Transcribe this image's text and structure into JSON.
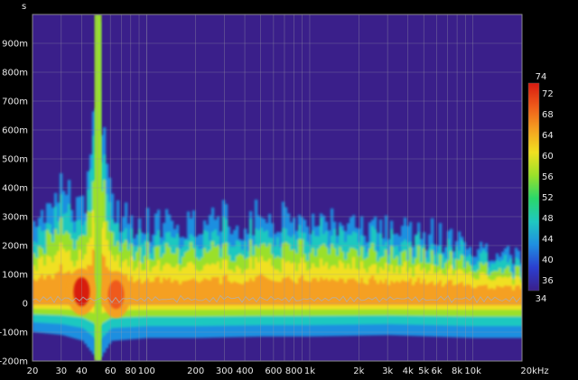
{
  "chart_data": {
    "type": "heatmap",
    "y_unit_label": "s",
    "x_scale": "log",
    "x_range_hz": [
      20,
      20000
    ],
    "y_range_ms": [
      -200,
      1000
    ],
    "x_ticks": [
      {
        "value": 20,
        "label": "20"
      },
      {
        "value": 30,
        "label": "30"
      },
      {
        "value": 40,
        "label": "40"
      },
      {
        "value": 60,
        "label": "60"
      },
      {
        "value": 80,
        "label": "80"
      },
      {
        "value": 100,
        "label": "100"
      },
      {
        "value": 200,
        "label": "200"
      },
      {
        "value": 300,
        "label": "300"
      },
      {
        "value": 400,
        "label": "400"
      },
      {
        "value": 600,
        "label": "600"
      },
      {
        "value": 800,
        "label": "800"
      },
      {
        "value": 1000,
        "label": "1k"
      },
      {
        "value": 2000,
        "label": "2k"
      },
      {
        "value": 3000,
        "label": "3k"
      },
      {
        "value": 4000,
        "label": "4k"
      },
      {
        "value": 5000,
        "label": "5k"
      },
      {
        "value": 6000,
        "label": "6k"
      },
      {
        "value": 8000,
        "label": "8k"
      },
      {
        "value": 10000,
        "label": "10k"
      },
      {
        "value": 20000,
        "label": "20kHz"
      }
    ],
    "y_ticks": [
      {
        "value": 900,
        "label": "900m"
      },
      {
        "value": 800,
        "label": "800m"
      },
      {
        "value": 700,
        "label": "700m"
      },
      {
        "value": 600,
        "label": "600m"
      },
      {
        "value": 500,
        "label": "500m"
      },
      {
        "value": 400,
        "label": "400m"
      },
      {
        "value": 300,
        "label": "300m"
      },
      {
        "value": 200,
        "label": "200m"
      },
      {
        "value": 100,
        "label": "100m"
      },
      {
        "value": 0,
        "label": "0"
      },
      {
        "value": -100,
        "label": "-100m"
      },
      {
        "value": -200,
        "label": "-200m"
      }
    ],
    "colorbar": {
      "range_db": [
        34,
        74
      ],
      "ticks": [
        {
          "value": 74,
          "label": "74"
        },
        {
          "value": 72,
          "label": "72"
        },
        {
          "value": 68,
          "label": "68"
        },
        {
          "value": 64,
          "label": "64"
        },
        {
          "value": 60,
          "label": "60"
        },
        {
          "value": 56,
          "label": "56"
        },
        {
          "value": 52,
          "label": "52"
        },
        {
          "value": 48,
          "label": "48"
        },
        {
          "value": 44,
          "label": "44"
        },
        {
          "value": 40,
          "label": "40"
        },
        {
          "value": 36,
          "label": "36"
        },
        {
          "value": 34,
          "label": "34"
        }
      ],
      "stops": [
        "#3a1f8a",
        "#2b3fd0",
        "#1f8fe0",
        "#1fc8c0",
        "#2ad86a",
        "#9ae02a",
        "#f0e020",
        "#f5a020",
        "#ef5a1a",
        "#d81a10"
      ]
    },
    "background_color": "#3a1f8a",
    "grid": true,
    "envelope_ms": [
      {
        "f": 20,
        "top": 320,
        "bottom": -100
      },
      {
        "f": 30,
        "top": 460,
        "bottom": -110
      },
      {
        "f": 40,
        "top": 370,
        "bottom": -130
      },
      {
        "f": 50,
        "top": 1000,
        "bottom": -200
      },
      {
        "f": 60,
        "top": 360,
        "bottom": -130
      },
      {
        "f": 100,
        "top": 300,
        "bottom": -120
      },
      {
        "f": 200,
        "top": 330,
        "bottom": -120
      },
      {
        "f": 500,
        "top": 320,
        "bottom": -115
      },
      {
        "f": 1000,
        "top": 330,
        "bottom": -115
      },
      {
        "f": 3000,
        "top": 300,
        "bottom": -110
      },
      {
        "f": 10000,
        "top": 230,
        "bottom": -120
      },
      {
        "f": 20000,
        "top": 170,
        "bottom": -120
      }
    ],
    "hot_spots": [
      {
        "f": 40,
        "t_ms": 40,
        "level_db": 72
      },
      {
        "f": 65,
        "t_ms": 30,
        "level_db": 70
      }
    ]
  }
}
